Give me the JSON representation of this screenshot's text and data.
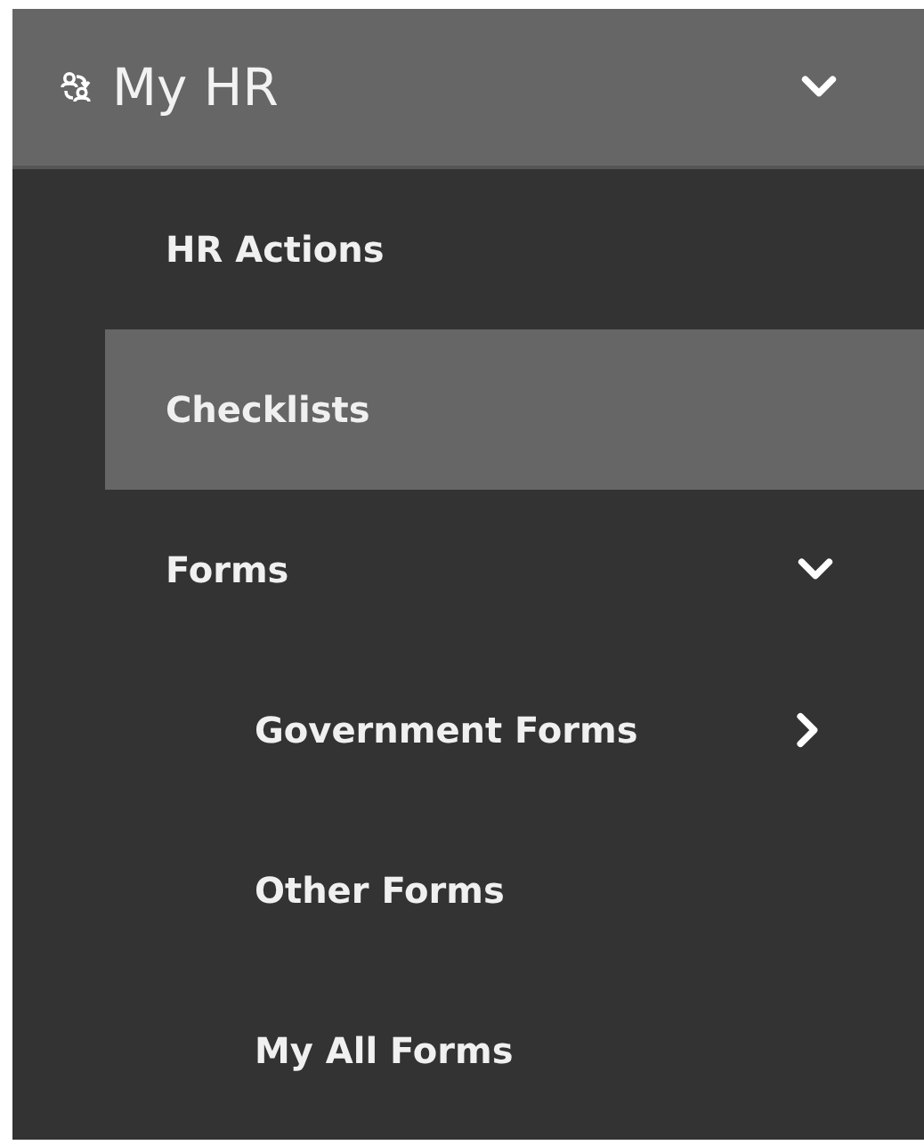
{
  "menu": {
    "title": "My HR",
    "expanded": true,
    "items": [
      {
        "label": "HR Actions",
        "selected": false
      },
      {
        "label": "Checklists",
        "selected": true
      },
      {
        "label": "Forms",
        "selected": false,
        "expanded": true,
        "children": [
          {
            "label": "Government Forms",
            "selected": false,
            "expanded": false
          },
          {
            "label": "Other Forms",
            "selected": false
          },
          {
            "label": "My All Forms",
            "selected": false
          }
        ]
      }
    ]
  }
}
